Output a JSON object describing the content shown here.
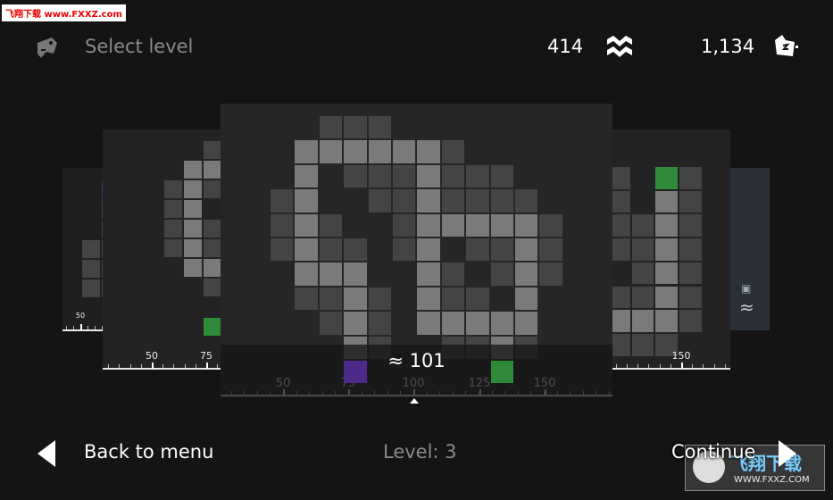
{
  "watermark_top": "飞翔下载 www.FXXZ.com",
  "watermark_bottom": {
    "title": "飞翔下载",
    "url": "WWW.FXXZ.COM"
  },
  "header": {
    "icon": "gamepad-icon",
    "title": "Select level",
    "waves_count": "414",
    "waves_icon": "waves-icon",
    "tickets_count": "1,134",
    "tickets_icon": "ticket-icon"
  },
  "colors": {
    "background": "#141414",
    "card": "#262626",
    "dark_cell": "#444444",
    "light_cell": "#7a7a7a",
    "purple": "#4b2a8a",
    "green": "#2f8a3a",
    "far_right_card": "#2a3035"
  },
  "main_card": {
    "value_label": "≈ 101",
    "ruler_labels": [
      "50",
      "75",
      "100",
      "125",
      "150"
    ],
    "grid": [
      "..ddd.......",
      ".LLLLLLd....",
      ".L.dddLddd..",
      "dL..ddLdddd.",
      "dLd..dLLLLLd",
      "dLdd.dL.ddLd",
      ".LLL..Ld.dLd",
      ".ddLd.Ldd.L.",
      "..dLd.LLLLL.",
      "...Ld..ddLd.",
      "...P.....G.."
    ]
  },
  "left_card": {
    "ruler_labels": [
      "50",
      "75"
    ],
    "grid": [
      "..d",
      ".LL",
      "dLd",
      "dL.",
      "dLd",
      "dLd",
      ".LL",
      "..d",
      "...",
      "..G"
    ]
  },
  "right_card": {
    "ruler_labels": [
      "150"
    ],
    "grid": [
      "d.Gd",
      "d.Ld",
      "ddLd",
      "ddLd",
      ".dLd",
      "ddLd",
      "LLLd",
      "ddd."
    ]
  },
  "far_left_card": {
    "ruler_labels": [
      "50"
    ],
    "grid": [
      "..P",
      "..d",
      "..d",
      ".dd",
      ".dd",
      ".dd"
    ]
  },
  "far_right_card": {
    "icons": [
      "ticket-icon",
      "waves-icon"
    ]
  },
  "footer": {
    "back_label": "Back to menu",
    "level_label": "Level: 3",
    "continue_label": "Continue"
  }
}
